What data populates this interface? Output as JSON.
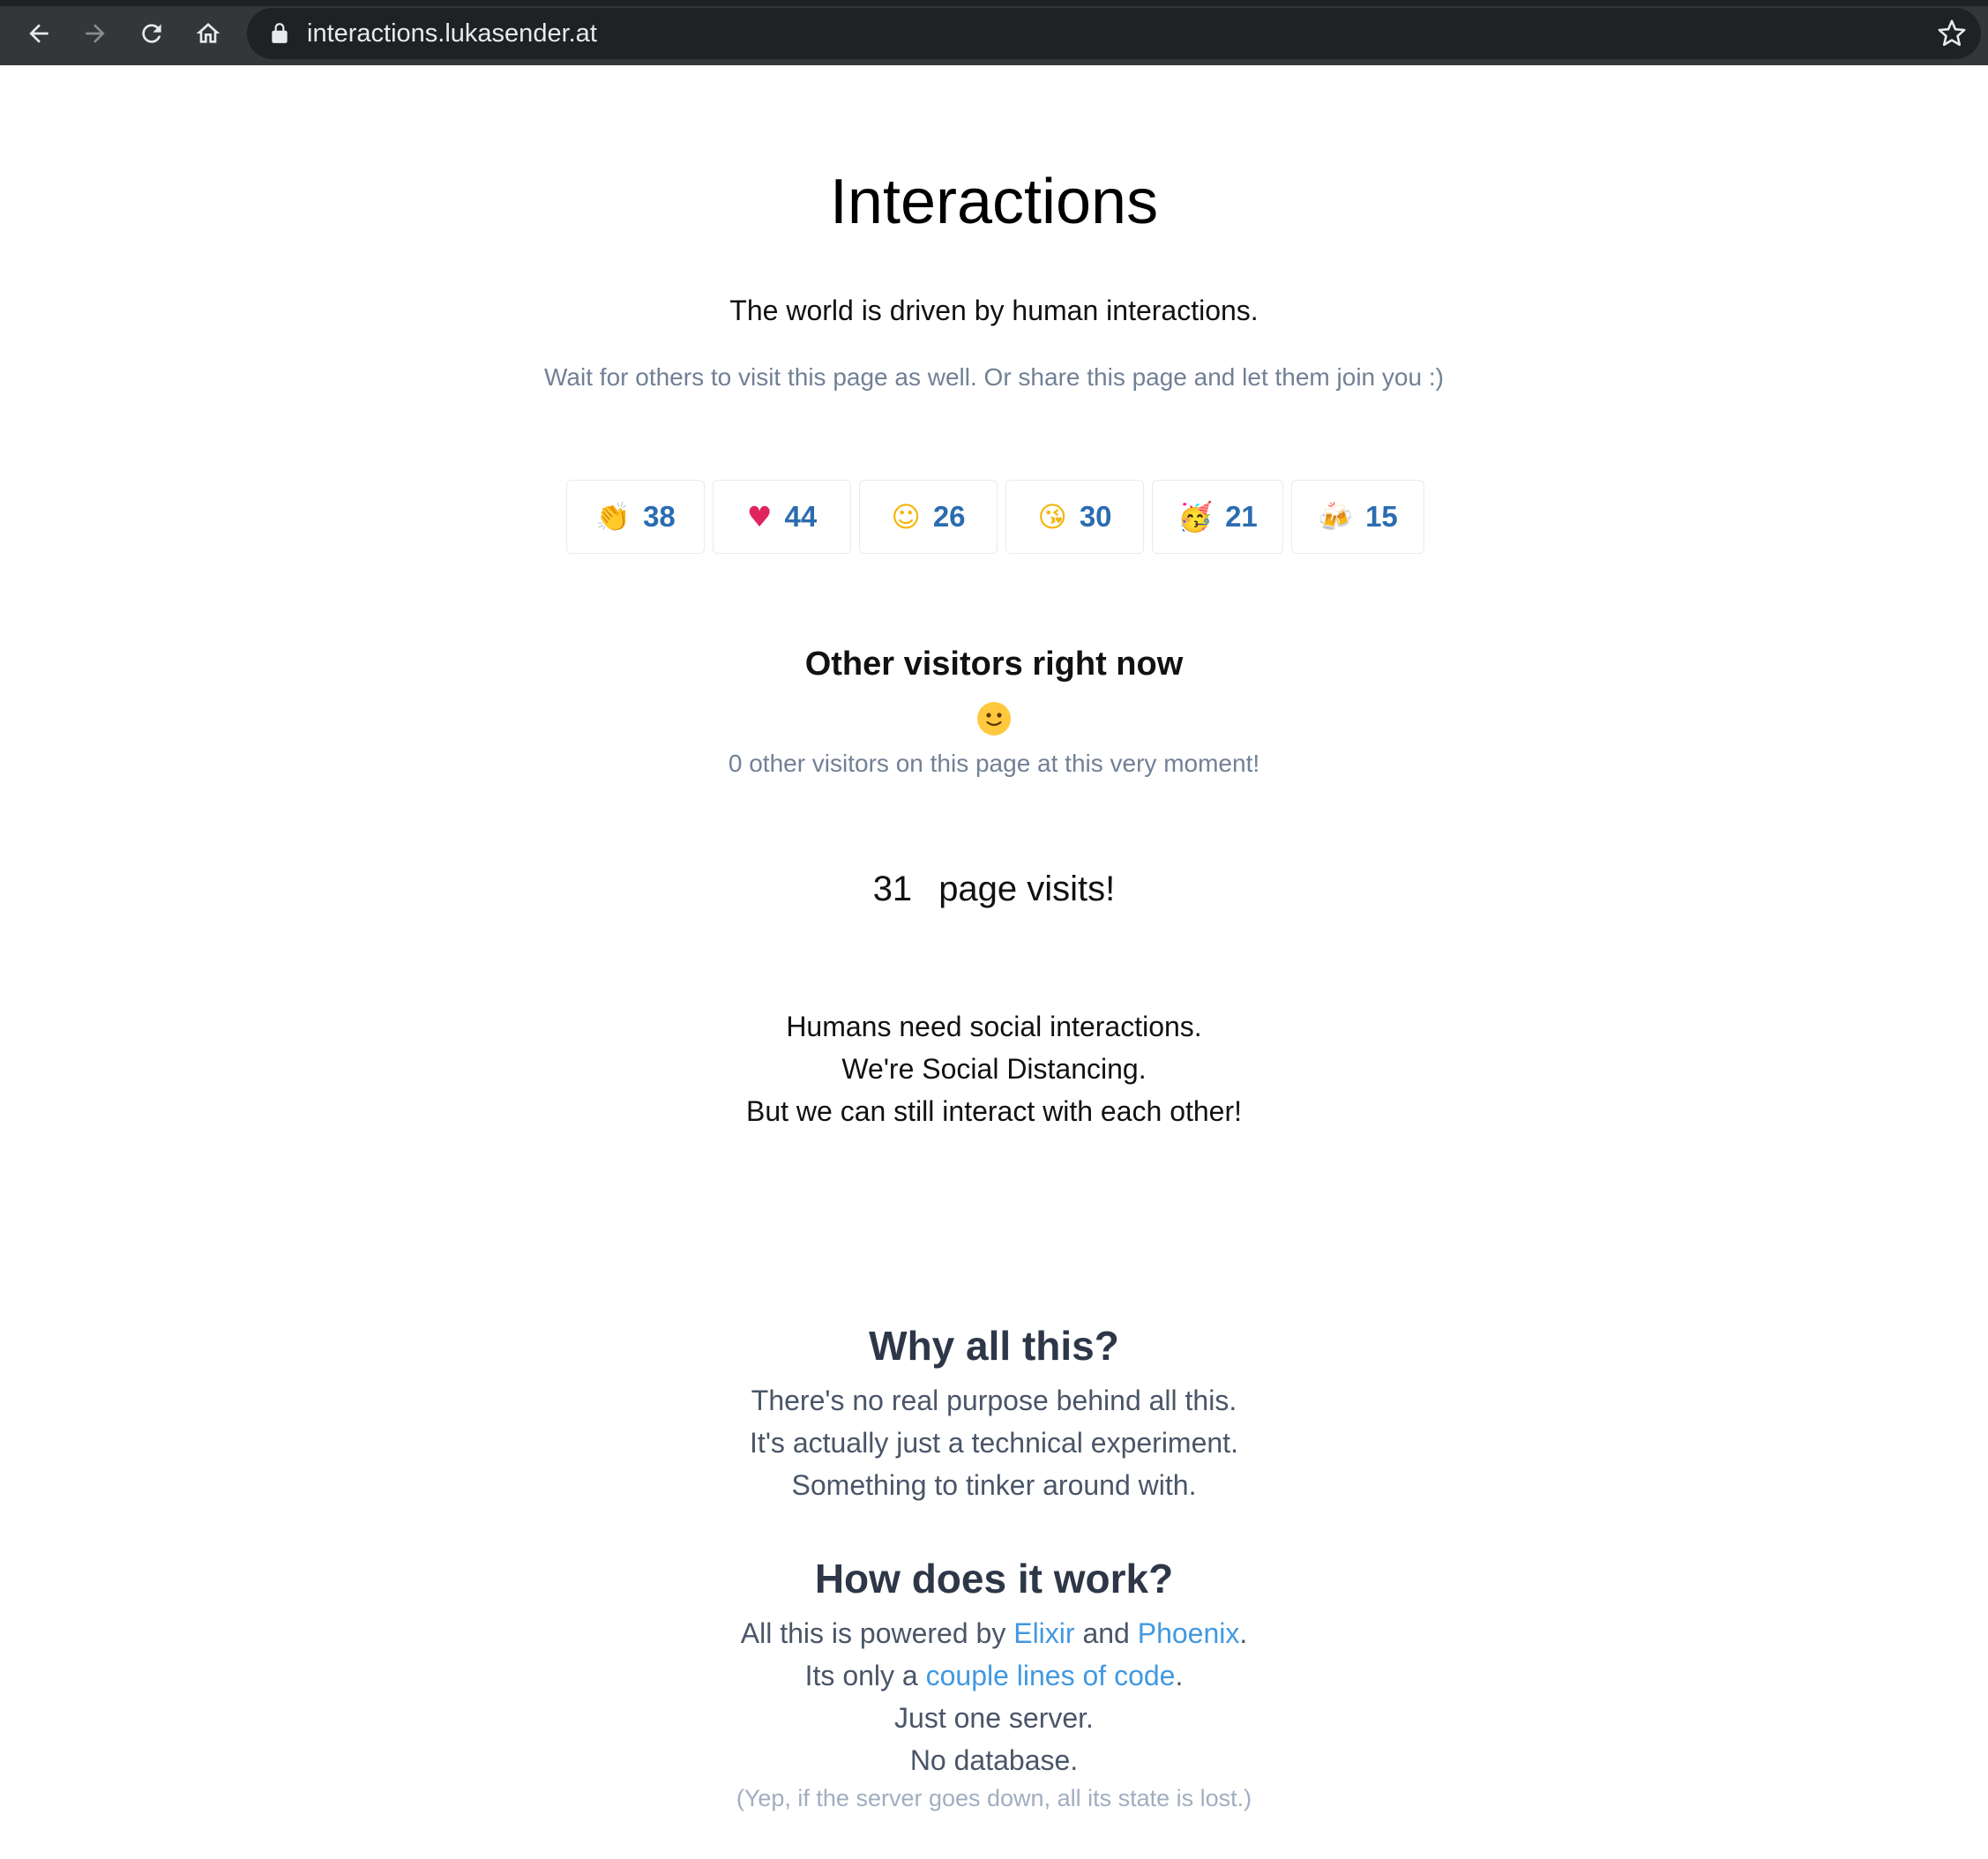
{
  "browser": {
    "url": "interactions.lukasender.at",
    "icons": [
      "back-icon",
      "forward-icon",
      "reload-icon",
      "home-icon",
      "lock-icon",
      "star-icon"
    ]
  },
  "page": {
    "title": "Interactions",
    "lead": "The world is driven by human interactions.",
    "hint": "Wait for others to visit this page as well. Or share this page and let them join you :)",
    "reactions": [
      {
        "emoji": "clapping-hands",
        "count": "38"
      },
      {
        "emoji": "red-heart",
        "count": "44"
      },
      {
        "emoji": "smiling-face",
        "count": "26"
      },
      {
        "emoji": "face-blowing-kiss",
        "count": "30"
      },
      {
        "emoji": "partying-face",
        "count": "21"
      },
      {
        "emoji": "clinking-beer-mugs",
        "count": "15"
      }
    ],
    "visitors": {
      "heading": "Other visitors right now",
      "text": "0 other visitors on this page at this very moment!"
    },
    "visits": {
      "count": "31",
      "label": "page visits!"
    },
    "human_lines": [
      "Humans need social interactions.",
      "We're Social Distancing.",
      "But we can still interact with each other!"
    ],
    "why": {
      "heading": "Why all this?",
      "lines": [
        "There's no real purpose behind all this.",
        "It's actually just a technical experiment.",
        "Something to tinker around with."
      ]
    },
    "how": {
      "heading": "How does it work?",
      "line1_prefix": "All this is powered by ",
      "link_elixir": "Elixir",
      "line1_mid": " and ",
      "link_phoenix": "Phoenix",
      "line1_suffix": ".",
      "line2_prefix": "Its only a ",
      "link_code": "couple lines of code",
      "line2_suffix": ".",
      "line3": "Just one server.",
      "line4": "No database.",
      "footnote": "(Yep, if the server goes down, all its state is lost.)"
    },
    "colors": {
      "link": "#4299e1",
      "count": "#2b6cb0",
      "muted": "#718096"
    }
  }
}
